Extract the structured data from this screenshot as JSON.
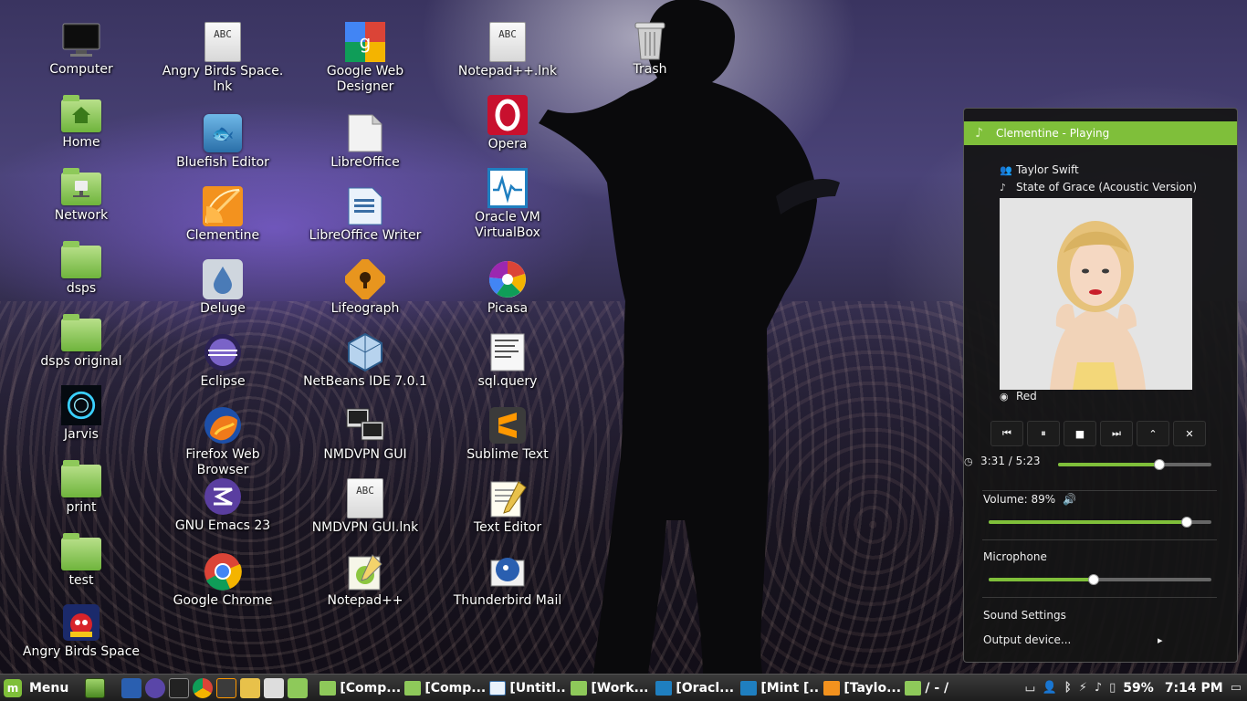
{
  "desktop": {
    "icons": [
      {
        "label": "Computer",
        "icon": "monitor-icon"
      },
      {
        "label": "Home",
        "icon": "home-folder-icon"
      },
      {
        "label": "Network",
        "icon": "network-folder-icon"
      },
      {
        "label": "dsps",
        "icon": "folder-icon"
      },
      {
        "label": "dsps original",
        "icon": "folder-icon"
      },
      {
        "label": "Jarvis",
        "icon": "jarvis-icon"
      },
      {
        "label": "print",
        "icon": "folder-icon"
      },
      {
        "label": "test",
        "icon": "folder-icon"
      },
      {
        "label": "Angry Birds Space",
        "icon": "angry-birds-space-icon"
      },
      {
        "label": "Angry Birds Space.\nlnk",
        "icon": "text-file-icon"
      },
      {
        "label": "Bluefish Editor",
        "icon": "bluefish-icon"
      },
      {
        "label": "Clementine",
        "icon": "clementine-icon"
      },
      {
        "label": "Deluge",
        "icon": "deluge-icon"
      },
      {
        "label": "Eclipse",
        "icon": "eclipse-icon"
      },
      {
        "label": "Firefox Web Browser",
        "icon": "firefox-icon"
      },
      {
        "label": "GNU Emacs 23",
        "icon": "emacs-icon"
      },
      {
        "label": "Google Chrome",
        "icon": "chrome-icon"
      },
      {
        "label": "Google Web\nDesigner",
        "icon": "google-web-designer-icon"
      },
      {
        "label": "LibreOffice",
        "icon": "libreoffice-icon"
      },
      {
        "label": "LibreOffice Writer",
        "icon": "libreoffice-writer-icon"
      },
      {
        "label": "Lifeograph",
        "icon": "lifeograph-icon"
      },
      {
        "label": "NetBeans IDE 7.0.1",
        "icon": "netbeans-icon"
      },
      {
        "label": "NMDVPN GUI",
        "icon": "nmdvpn-icon"
      },
      {
        "label": "NMDVPN GUI.lnk",
        "icon": "text-file-icon"
      },
      {
        "label": "Notepad++",
        "icon": "notepad-plus-plus-icon"
      },
      {
        "label": "Notepad++.lnk",
        "icon": "text-file-icon"
      },
      {
        "label": "Opera",
        "icon": "opera-icon"
      },
      {
        "label": "Oracle VM\nVirtualBox",
        "icon": "virtualbox-icon"
      },
      {
        "label": "Picasa",
        "icon": "picasa-icon"
      },
      {
        "label": "sql.query",
        "icon": "sql-file-icon"
      },
      {
        "label": "Sublime Text",
        "icon": "sublime-text-icon"
      },
      {
        "label": "Text Editor",
        "icon": "text-editor-icon"
      },
      {
        "label": "Thunderbird Mail",
        "icon": "thunderbird-icon"
      },
      {
        "label": "Trash",
        "icon": "trash-icon"
      }
    ]
  },
  "sound_applet": {
    "header": "Clementine - Playing",
    "artist": "Taylor Swift",
    "track": "State of Grace (Acoustic Version)",
    "album": "Red",
    "position": "3:31 / 5:23",
    "progress": 0.66,
    "volume_label": "Volume: 89%",
    "volume": 0.89,
    "microphone_label": "Microphone",
    "microphone": 0.47,
    "sound_settings": "Sound Settings",
    "output_device": "Output device...",
    "output_arrow": "▸",
    "controls": [
      "previous-icon",
      "pause-icon",
      "stop-icon",
      "next-icon",
      "raise-icon",
      "close-icon"
    ]
  },
  "taskbar": {
    "menu_label": "Menu",
    "windows": [
      {
        "label": "[Comp..."
      },
      {
        "label": "[Comp..."
      },
      {
        "label": "[Untitl..."
      },
      {
        "label": "[Work..."
      },
      {
        "label": "[Oracl..."
      },
      {
        "label": "[Mint [..."
      },
      {
        "label": "[Taylo..."
      },
      {
        "label": "/ - /"
      }
    ],
    "battery": "59%",
    "clock": "7:14 PM"
  },
  "colors": {
    "accent": "#7fbf3a",
    "panel_bg": "#141414"
  }
}
